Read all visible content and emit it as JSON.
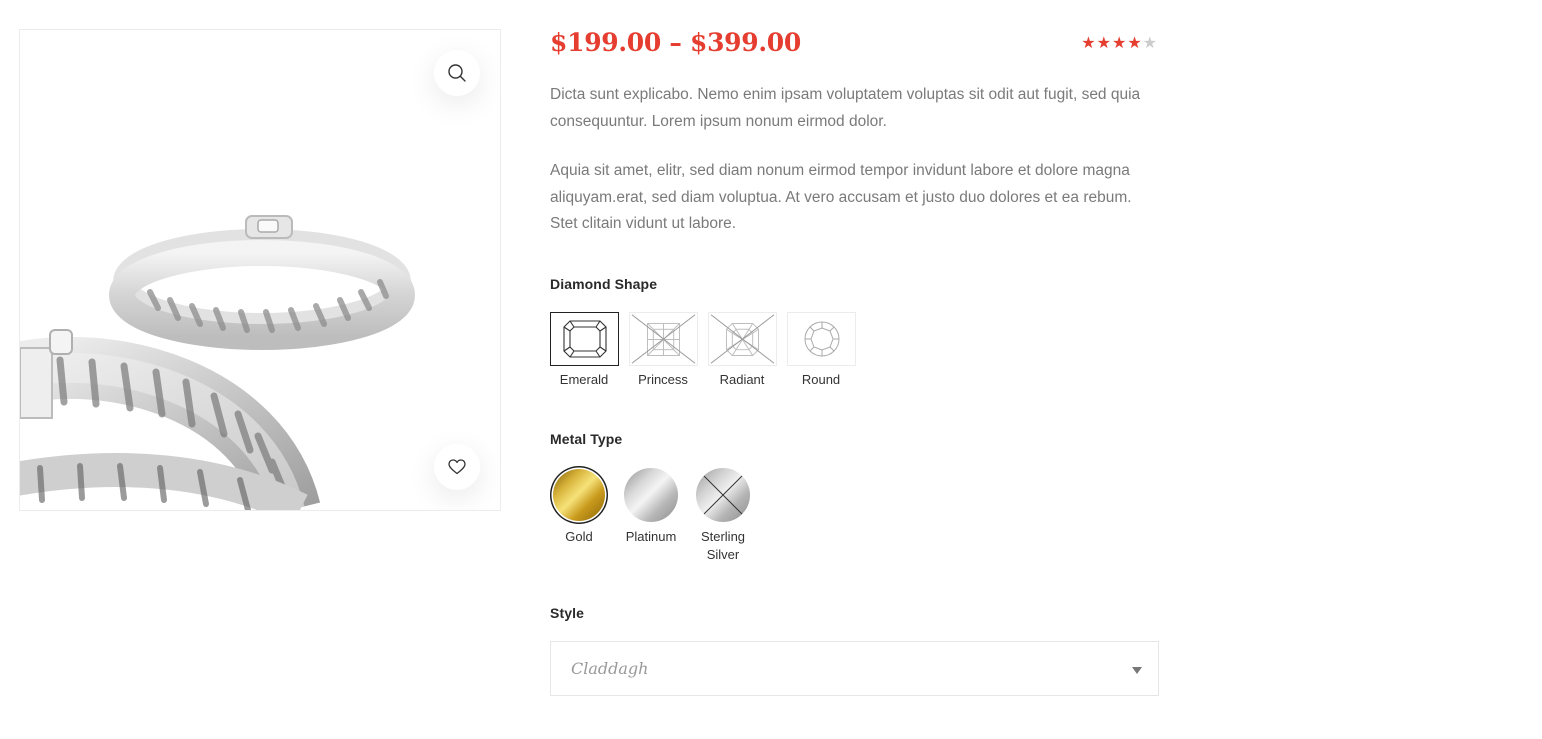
{
  "product": {
    "price_range": "$199.00 – $399.00",
    "rating": {
      "value": 4,
      "max": 5
    },
    "description": [
      "Dicta sunt explicabo. Nemo enim ipsam voluptatem voluptas sit odit aut fugit, sed quia consequuntur. Lorem ipsum nonum eirmod dolor.",
      "Aquia sit amet, elitr, sed diam nonum eirmod tempor invidunt labore et dolore magna aliquyam.erat, sed diam voluptua. At vero accusam et justo duo dolores et ea rebum. Stet clitain vidunt ut labore."
    ]
  },
  "gallery": {
    "zoom_icon": "magnifier-icon",
    "wishlist_icon": "heart-icon"
  },
  "diamond_shape": {
    "label": "Diamond Shape",
    "options": [
      {
        "name": "Emerald",
        "selected": true,
        "available": true
      },
      {
        "name": "Princess",
        "selected": false,
        "available": false
      },
      {
        "name": "Radiant",
        "selected": false,
        "available": false
      },
      {
        "name": "Round",
        "selected": false,
        "available": true
      }
    ]
  },
  "metal_type": {
    "label": "Metal Type",
    "options": [
      {
        "name": "Gold",
        "selected": true,
        "available": true
      },
      {
        "name": "Platinum",
        "selected": false,
        "available": true
      },
      {
        "name": "Sterling Silver",
        "selected": false,
        "available": false
      }
    ]
  },
  "style": {
    "label": "Style",
    "selected": "Claddagh"
  },
  "colors": {
    "accent": "#e53d2f",
    "star_filled": "#e53d2f",
    "star_empty": "#cccccc",
    "text_muted": "#7a7a7a"
  }
}
